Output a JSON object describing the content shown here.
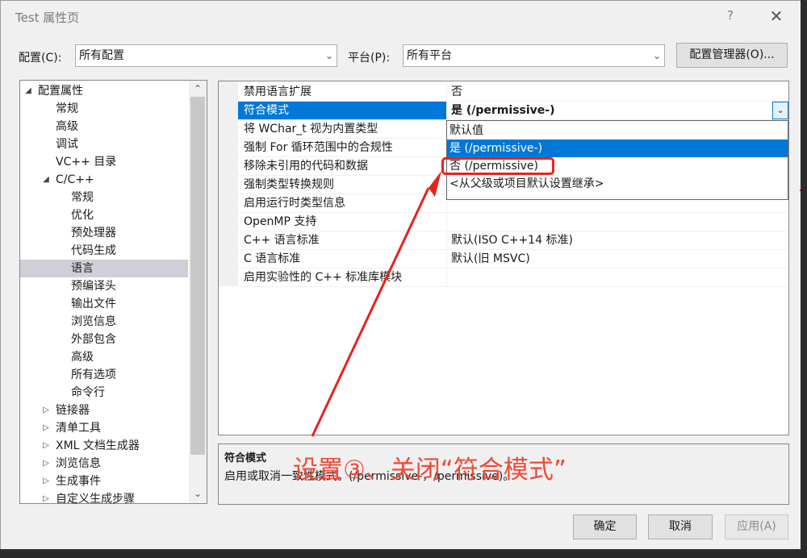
{
  "window": {
    "title": "Test 属性页",
    "help": "?",
    "close": "✕"
  },
  "config_row": {
    "config_label": "配置(C):",
    "config_value": "所有配置",
    "platform_label": "平台(P):",
    "platform_value": "所有平台",
    "manager_button": "配置管理器(O)..."
  },
  "tree": [
    {
      "label": "配置属性",
      "indent": 0,
      "expander": "◢",
      "expanded": true
    },
    {
      "label": "常规",
      "indent": 1
    },
    {
      "label": "高级",
      "indent": 1
    },
    {
      "label": "调试",
      "indent": 1
    },
    {
      "label": "VC++ 目录",
      "indent": 1
    },
    {
      "label": "C/C++",
      "indent": 1,
      "expander": "◢",
      "expanded": true
    },
    {
      "label": "常规",
      "indent": 2
    },
    {
      "label": "优化",
      "indent": 2
    },
    {
      "label": "预处理器",
      "indent": 2
    },
    {
      "label": "代码生成",
      "indent": 2
    },
    {
      "label": "语言",
      "indent": 2,
      "selected": true
    },
    {
      "label": "预编译头",
      "indent": 2
    },
    {
      "label": "输出文件",
      "indent": 2
    },
    {
      "label": "浏览信息",
      "indent": 2
    },
    {
      "label": "外部包含",
      "indent": 2
    },
    {
      "label": "高级",
      "indent": 2
    },
    {
      "label": "所有选项",
      "indent": 2
    },
    {
      "label": "命令行",
      "indent": 2
    },
    {
      "label": "链接器",
      "indent": 1,
      "expander": "▷"
    },
    {
      "label": "清单工具",
      "indent": 1,
      "expander": "▷"
    },
    {
      "label": "XML 文档生成器",
      "indent": 1,
      "expander": "▷"
    },
    {
      "label": "浏览信息",
      "indent": 1,
      "expander": "▷"
    },
    {
      "label": "生成事件",
      "indent": 1,
      "expander": "▷"
    },
    {
      "label": "自定义生成步骤",
      "indent": 1,
      "expander": "▷"
    }
  ],
  "properties": [
    {
      "name": "禁用语言扩展",
      "value": "否"
    },
    {
      "name": "符合模式",
      "value": "是 (/permissive-)",
      "active": true
    },
    {
      "name": "将 WChar_t 视为内置类型",
      "value": ""
    },
    {
      "name": "强制 For 循环范围中的合规性",
      "value": ""
    },
    {
      "name": "移除未引用的代码和数据",
      "value": ""
    },
    {
      "name": "强制类型转换规则",
      "value": ""
    },
    {
      "name": "启用运行时类型信息",
      "value": ""
    },
    {
      "name": "OpenMP 支持",
      "value": ""
    },
    {
      "name": "C++ 语言标准",
      "value": "默认(ISO C++14 标准)"
    },
    {
      "name": "C 语言标准",
      "value": "默认(旧 MSVC)"
    },
    {
      "name": "启用实验性的 C++ 标准库模块",
      "value": ""
    }
  ],
  "dropdown": {
    "items": [
      {
        "label": "默认值"
      },
      {
        "label": "是 (/permissive-)",
        "highlighted": true
      },
      {
        "label": "否 (/permissive)",
        "circled": true
      },
      {
        "label": "<从父级或项目默认设置继承>"
      }
    ]
  },
  "description": {
    "title": "符合模式",
    "text": "启用或取消一致性模式。(/permissive-，/permissive)。"
  },
  "annotation": {
    "text": "设置③、关闭“符合模式”",
    "color": "#f04a3a"
  },
  "buttons": {
    "ok": "确定",
    "cancel": "取消",
    "apply": "应用(A)"
  },
  "colors": {
    "selection": "#0078d7",
    "annotation_red": "#e8231b"
  }
}
